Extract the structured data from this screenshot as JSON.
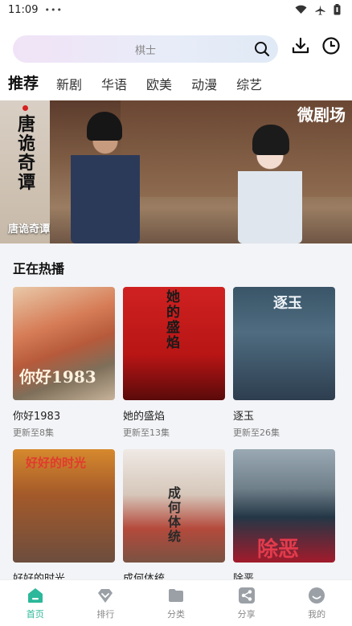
{
  "status_bar": {
    "time": "11:09",
    "dots": "•••"
  },
  "search": {
    "placeholder": "棋士"
  },
  "tabs": [
    {
      "label": "推荐",
      "active": true
    },
    {
      "label": "新剧"
    },
    {
      "label": "华语"
    },
    {
      "label": "欧美"
    },
    {
      "label": "动漫"
    },
    {
      "label": "综艺"
    }
  ],
  "banner": {
    "caption": "唐诡奇谭",
    "calligraphy": [
      "唐",
      "诡",
      "奇",
      "谭"
    ],
    "brand": "微剧场"
  },
  "section": {
    "title": "正在热播"
  },
  "cards": [
    {
      "title": "你好1983",
      "subtitle": "更新至8集",
      "poster_text": "你好1983"
    },
    {
      "title": "她的盛焰",
      "subtitle": "更新至13集",
      "poster_text": "她的盛焰"
    },
    {
      "title": "逐玉",
      "subtitle": "更新至26集",
      "poster_text": "逐玉"
    },
    {
      "title": "好好的时光",
      "subtitle": "",
      "poster_text": "好好的时光"
    },
    {
      "title": "成何体统",
      "subtitle": "",
      "poster_text": "成何体统"
    },
    {
      "title": "除恶",
      "subtitle": "",
      "poster_text": "除恶"
    }
  ],
  "bottom_nav": [
    {
      "label": "首页",
      "icon": "home-icon",
      "active": true
    },
    {
      "label": "排行",
      "icon": "ranking-icon"
    },
    {
      "label": "分类",
      "icon": "folder-icon"
    },
    {
      "label": "分享",
      "icon": "share-icon"
    },
    {
      "label": "我的",
      "icon": "profile-icon"
    }
  ],
  "colors": {
    "accent": "#2cb89a",
    "search_gradient_start": "#f1e3f7",
    "section_bg": "#f3f4f7"
  }
}
